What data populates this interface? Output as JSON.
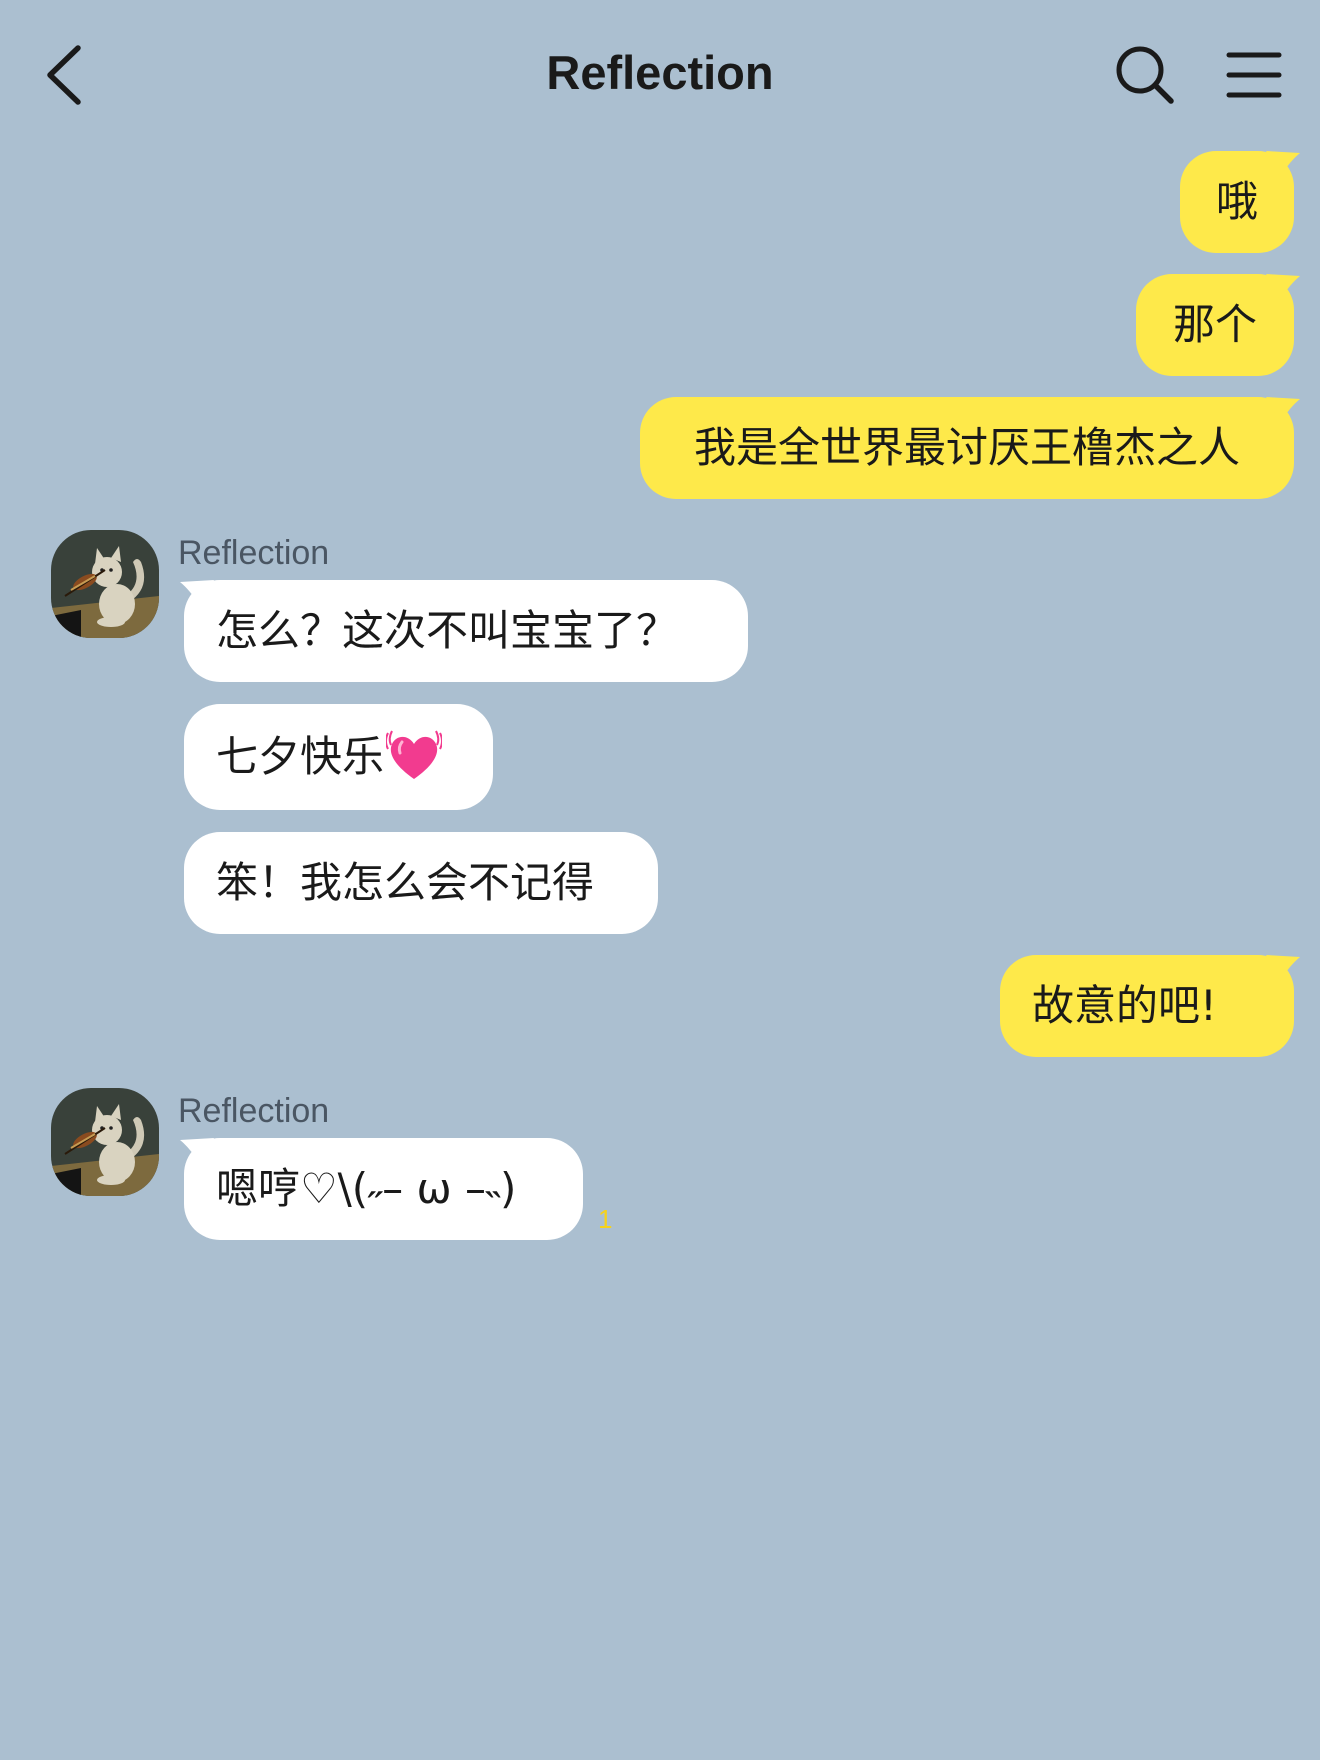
{
  "header": {
    "title": "Reflection",
    "back_icon": "chevron-left-icon",
    "search_icon": "search-icon",
    "menu_icon": "hamburger-menu-icon"
  },
  "colors": {
    "background": "#abbfd0",
    "my_bubble": "#fee94a",
    "their_bubble": "#ffffff",
    "unread": "#f5d21b"
  },
  "messages": [
    {
      "from": "me",
      "text": "哦"
    },
    {
      "from": "me",
      "text": "那个"
    },
    {
      "from": "me",
      "text": "我是全世界最讨厌王橹杰之人"
    },
    {
      "from": "them",
      "sender": "Reflection",
      "text": "怎么？这次不叫宝宝了？"
    },
    {
      "from": "them",
      "text": "七夕快乐",
      "emoji": "pink-heart-icon"
    },
    {
      "from": "them",
      "text": "笨！我怎么会不记得"
    },
    {
      "from": "me",
      "text": "故意的吧!"
    },
    {
      "from": "them",
      "sender": "Reflection",
      "text": "嗯哼♡\\(˶– ω –˵)",
      "unread": "1"
    }
  ]
}
